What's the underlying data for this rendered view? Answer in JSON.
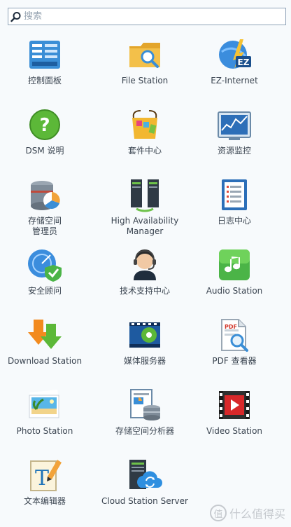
{
  "search": {
    "placeholder": "搜索"
  },
  "apps": [
    {
      "label": "控制面板",
      "icon": "control-panel-icon"
    },
    {
      "label": "File Station",
      "icon": "file-station-icon"
    },
    {
      "label": "EZ-Internet",
      "icon": "ez-internet-icon"
    },
    {
      "label": "DSM 说明",
      "icon": "help-icon"
    },
    {
      "label": "套件中心",
      "icon": "package-center-icon"
    },
    {
      "label": "资源监控",
      "icon": "resource-monitor-icon"
    },
    {
      "label": "存储空间\n管理员",
      "icon": "storage-manager-icon"
    },
    {
      "label": "High Availability\nManager",
      "icon": "high-availability-icon"
    },
    {
      "label": "日志中心",
      "icon": "log-center-icon"
    },
    {
      "label": "安全顾问",
      "icon": "security-advisor-icon"
    },
    {
      "label": "技术支持中心",
      "icon": "support-center-icon"
    },
    {
      "label": "Audio Station",
      "icon": "audio-station-icon"
    },
    {
      "label": "Download Station",
      "icon": "download-station-icon"
    },
    {
      "label": "媒体服务器",
      "icon": "media-server-icon"
    },
    {
      "label": "PDF 查看器",
      "icon": "pdf-viewer-icon"
    },
    {
      "label": "Photo Station",
      "icon": "photo-station-icon"
    },
    {
      "label": "存储空间分析器",
      "icon": "storage-analyzer-icon"
    },
    {
      "label": "Video Station",
      "icon": "video-station-icon"
    },
    {
      "label": "文本编辑器",
      "icon": "text-editor-icon"
    },
    {
      "label": "Cloud Station Server",
      "icon": "cloud-station-icon"
    }
  ],
  "watermark": {
    "badge": "值",
    "text": "什么值得买"
  }
}
